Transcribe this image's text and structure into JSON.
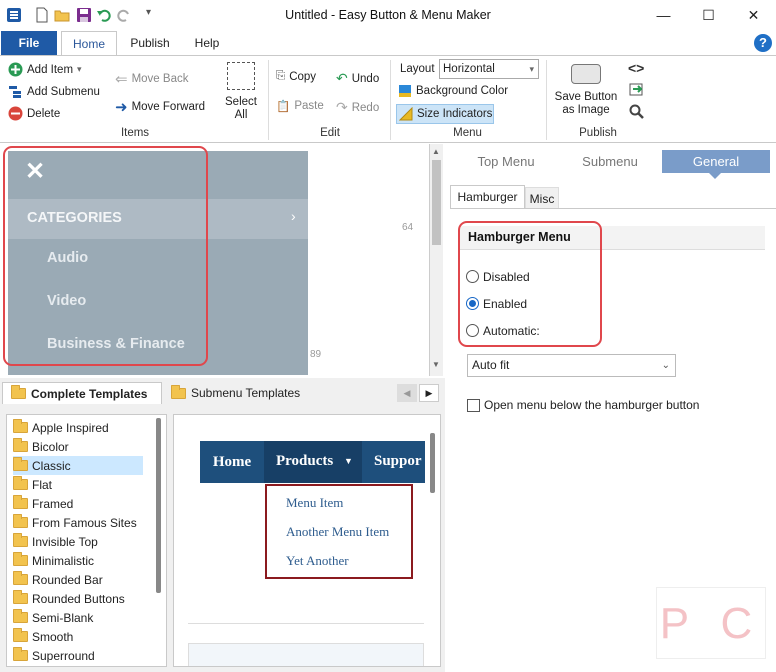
{
  "window": {
    "title": "Untitled - Easy Button & Menu Maker",
    "minimize": "—",
    "maximize": "☐",
    "close": "✕"
  },
  "tabs": {
    "file": "File",
    "home": "Home",
    "publish": "Publish",
    "help": "Help"
  },
  "ribbon": {
    "items": {
      "add_item": "Add Item",
      "add_submenu": "Add Submenu",
      "delete": "Delete",
      "move_back": "Move Back",
      "move_forward": "Move Forward",
      "select_all": "Select All",
      "group": "Items"
    },
    "edit": {
      "copy": "Copy",
      "paste": "Paste",
      "undo": "Undo",
      "redo": "Redo",
      "group": "Edit"
    },
    "menu": {
      "layout_label": "Layout",
      "layout_value": "Horizontal",
      "background_color": "Background Color",
      "size_indicators": "Size Indicators",
      "group": "Menu"
    },
    "publish": {
      "save_button": "Save Button as Image",
      "group": "Publish"
    }
  },
  "preview": {
    "close_glyph": "✕",
    "categories": "CATEGORIES",
    "chevron": "›",
    "items": [
      "Audio",
      "Video",
      "Business & Finance"
    ],
    "ruler_64": "64",
    "ruler_89": "89"
  },
  "template_tabs": {
    "complete": "Complete Templates",
    "submenu": "Submenu Templates"
  },
  "templates": [
    "Apple Inspired",
    "Bicolor",
    "Classic",
    "Flat",
    "Framed",
    "From Famous Sites",
    "Invisible Top",
    "Minimalistic",
    "Rounded Bar",
    "Rounded Buttons",
    "Semi-Blank",
    "Smooth",
    "Superround"
  ],
  "selected_template": "Classic",
  "template_preview": {
    "nav": [
      "Home",
      "Products",
      "Suppor"
    ],
    "submenu": [
      "Menu Item",
      "Another Menu Item",
      "Yet Another"
    ]
  },
  "settings": {
    "tabs": [
      "Top Menu",
      "Submenu",
      "General"
    ],
    "subtabs": [
      "Hamburger",
      "Misc"
    ],
    "section_title": "Hamburger Menu",
    "options": [
      "Disabled",
      "Enabled",
      "Automatic:"
    ],
    "selected": "Enabled",
    "fit_value": "Auto fit",
    "checkbox_label": "Open menu below the hamburger button"
  },
  "colors": {
    "accent": "#1f5aa6",
    "hamburger_bg": "#9aaab5",
    "highlight": "#e0474c",
    "nav_bg": "#1e4f7c",
    "nav_active": "#173f66"
  }
}
